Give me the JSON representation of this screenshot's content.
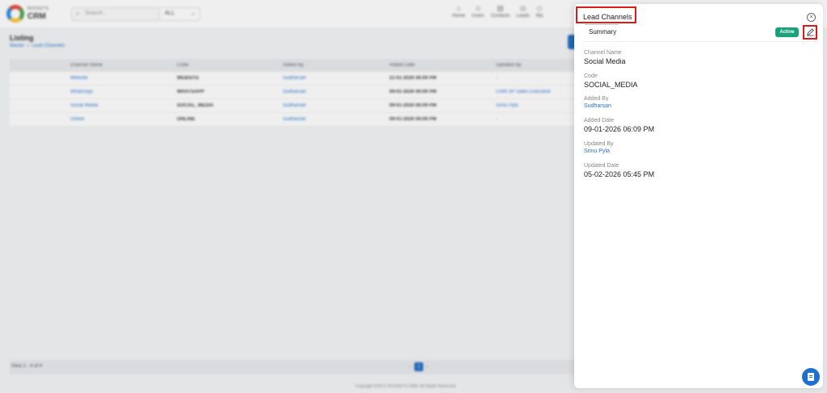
{
  "app": {
    "logo_small": "ROCKETS",
    "logo_big": "CRM",
    "search_placeholder": "Search...",
    "search_scope": "ALL",
    "nav": [
      {
        "label": "Home",
        "icon": "home-icon"
      },
      {
        "label": "Users",
        "icon": "user-icon"
      },
      {
        "label": "Contacts",
        "icon": "contacts-icon"
      },
      {
        "label": "Leads",
        "icon": "leads-icon"
      },
      {
        "label": "Ma",
        "icon": "more-icon"
      }
    ]
  },
  "listing": {
    "title": "Listing",
    "breadcrumb": [
      "Master",
      "Lead Channels"
    ],
    "columns": [
      "",
      "Channel Name",
      "Code",
      "Added By",
      "Added Date",
      "Updated By"
    ],
    "rows": [
      {
        "name": "Website",
        "code": "WEBSITE",
        "added_by": "Sudharsan",
        "added_date": "21-01-2026 06:09 PM",
        "updated_by": "-"
      },
      {
        "name": "WhatsApp",
        "code": "WHATSAPP",
        "added_by": "Sudharsan",
        "added_date": "09-01-2026 06:09 PM",
        "updated_by": "CRM SP Sales Executive"
      },
      {
        "name": "Social Media",
        "code": "SOCIAL_MEDIA",
        "added_by": "Sudharsan",
        "added_date": "09-01-2026 06:09 PM",
        "updated_by": "Srinu Pyla"
      },
      {
        "name": "Online",
        "code": "ONLINE",
        "added_by": "Sudharsan",
        "added_date": "09-01-2026 06:09 PM",
        "updated_by": "-"
      }
    ],
    "footer_info": "View 1 - 4 of 4",
    "current_page": "1",
    "copyright": "Copyright 2026 © ROCKETS CRM. All Rights Reserved."
  },
  "drawer": {
    "title": "Lead Channels",
    "tab": "Summary",
    "status": "Active",
    "fields": {
      "channel_name_label": "Channel Name",
      "channel_name": "Social Media",
      "code_label": "Code",
      "code": "SOCIAL_MEDIA",
      "added_by_label": "Added By",
      "added_by": "Sudharsan",
      "added_date_label": "Added Date",
      "added_date": "09-01-2026 06:09 PM",
      "updated_by_label": "Updated By",
      "updated_by": "Srinu Pyla",
      "updated_date_label": "Updated Date",
      "updated_date": "05-02-2026 05:45 PM"
    }
  },
  "colors": {
    "accent": "#1e6fd0",
    "active_badge": "#1aa37a",
    "highlight": "#e01919"
  }
}
